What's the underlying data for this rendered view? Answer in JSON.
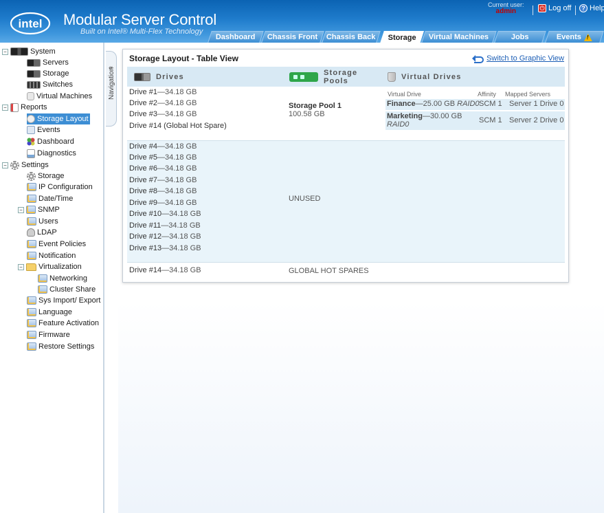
{
  "header": {
    "app_title": "Modular Server Control",
    "app_subtitle": "Built on Intel® Multi-Flex Technology",
    "logo_text": "intel",
    "current_user_label": "Current user:",
    "current_user": "admin",
    "logoff_label": "Log off",
    "help_label": "Help"
  },
  "tabs": [
    {
      "label": "Dashboard"
    },
    {
      "label": "Chassis Front"
    },
    {
      "label": "Chassis Back"
    },
    {
      "label": "Storage"
    },
    {
      "label": "Virtual Machines"
    },
    {
      "label": "Jobs"
    },
    {
      "label": "Events"
    }
  ],
  "nav": {
    "label": "Navigation",
    "collapse": "«",
    "items": [
      {
        "label": "System"
      },
      {
        "label": "Servers"
      },
      {
        "label": "Storage"
      },
      {
        "label": "Switches"
      },
      {
        "label": "Virtual Machines"
      },
      {
        "label": "Reports"
      },
      {
        "label": "Storage Layout"
      },
      {
        "label": "Events"
      },
      {
        "label": "Dashboard"
      },
      {
        "label": "Diagnostics"
      },
      {
        "label": "Settings"
      },
      {
        "label": "Storage"
      },
      {
        "label": "IP Configuration"
      },
      {
        "label": "Date/Time"
      },
      {
        "label": "SNMP"
      },
      {
        "label": "Users"
      },
      {
        "label": "LDAP"
      },
      {
        "label": "Event Policies"
      },
      {
        "label": "Notification"
      },
      {
        "label": "Virtualization"
      },
      {
        "label": "Networking"
      },
      {
        "label": "Cluster Share"
      },
      {
        "label": "Sys Import/ Export"
      },
      {
        "label": "Language"
      },
      {
        "label": "Feature Activation"
      },
      {
        "label": "Firmware"
      },
      {
        "label": "Restore Settings"
      }
    ]
  },
  "panel": {
    "title": "Storage Layout - Table View",
    "switch_link": "Switch to Graphic View",
    "col_drives": "Drives",
    "col_pools": "Storage Pools",
    "col_vdrives": "Virtual Drives",
    "vd_col_name": "Virtual Drive",
    "vd_col_affinity": "Affinity",
    "vd_col_mapped": "Mapped Servers",
    "group1": {
      "drives": [
        {
          "name": "Drive #1",
          "size": "—34.18 GB"
        },
        {
          "name": "Drive #2",
          "size": "—34.18 GB"
        },
        {
          "name": "Drive #3",
          "size": "—34.18 GB"
        },
        {
          "name": "Drive #14",
          "size": " (Global Hot Spare)"
        }
      ],
      "pool_name": "Storage Pool 1",
      "pool_size": "100.58 GB",
      "virtual_drives": [
        {
          "name": "Finance",
          "size": "—25.00 GB",
          "raid": "RAID0",
          "affinity": "SCM 1",
          "mapped": "Server 1 Drive 0"
        },
        {
          "name": "Marketing",
          "size": "—30.00 GB",
          "raid": "RAID0",
          "affinity": "SCM 1",
          "mapped": "Server 2 Drive 0"
        }
      ]
    },
    "group2": {
      "drives": [
        {
          "name": "Drive #4",
          "size": "—34.18 GB"
        },
        {
          "name": "Drive #5",
          "size": "—34.18 GB"
        },
        {
          "name": "Drive #6",
          "size": "—34.18 GB"
        },
        {
          "name": "Drive #7",
          "size": "—34.18 GB"
        },
        {
          "name": "Drive #8",
          "size": "—34.18 GB"
        },
        {
          "name": "Drive #9",
          "size": "—34.18 GB"
        },
        {
          "name": "Drive #10",
          "size": "—34.18 GB"
        },
        {
          "name": "Drive #11",
          "size": "—34.18 GB"
        },
        {
          "name": "Drive #12",
          "size": "—34.18 GB"
        },
        {
          "name": "Drive #13",
          "size": "—34.18 GB"
        }
      ],
      "status": "UNUSED"
    },
    "group3": {
      "drives": [
        {
          "name": "Drive #14",
          "size": "—34.18 GB"
        }
      ],
      "status": "GLOBAL HOT SPARES"
    }
  },
  "colors": {
    "header_blue": "#1f7ccc",
    "selected_nav": "#3d8ed4",
    "table_header_bg": "#d8e9f4",
    "unused_row_bg": "#e9f4fa",
    "link_blue": "#1a5db5",
    "user_red": "#c00000"
  }
}
